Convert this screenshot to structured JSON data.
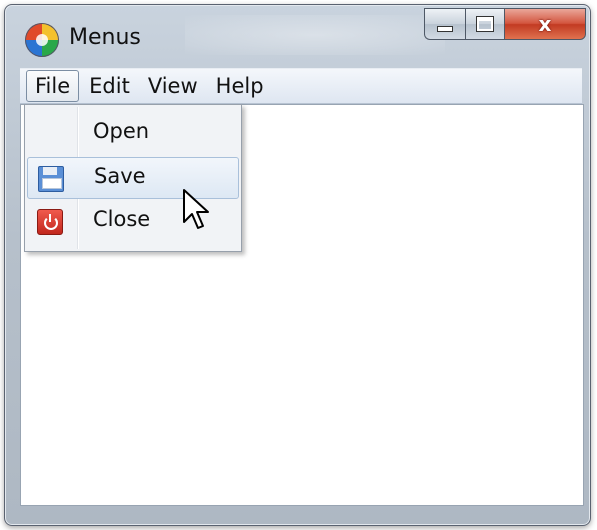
{
  "window": {
    "title": "Menus"
  },
  "caption": {
    "close_glyph": "x"
  },
  "menubar": {
    "items": [
      {
        "label": "File"
      },
      {
        "label": "Edit"
      },
      {
        "label": "View"
      },
      {
        "label": "Help"
      }
    ]
  },
  "file_menu": {
    "items": [
      {
        "label": "Open",
        "icon": "none"
      },
      {
        "label": "Save",
        "icon": "save-icon"
      },
      {
        "label": "Close",
        "icon": "power-icon"
      }
    ]
  }
}
